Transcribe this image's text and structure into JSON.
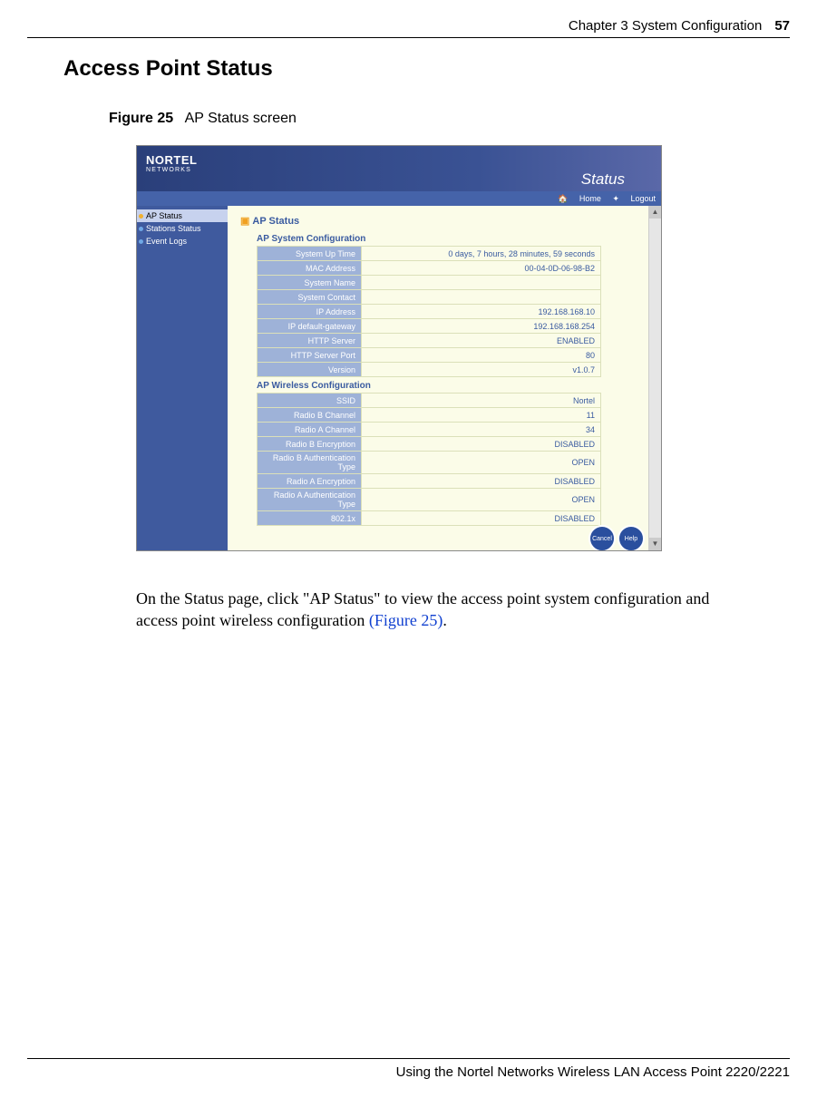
{
  "header": {
    "chapter": "Chapter 3  System Configuration",
    "page_number": "57"
  },
  "section_title": "Access Point Status",
  "figure": {
    "label": "Figure 25",
    "caption": "AP Status screen"
  },
  "banner": {
    "brand": "NORTEL",
    "brand_sub": "NETWORKS",
    "title": "Status"
  },
  "topbar": {
    "home": "Home",
    "logout": "Logout"
  },
  "sidebar": {
    "items": [
      {
        "label": "AP Status",
        "active": true
      },
      {
        "label": "Stations Status",
        "active": false
      },
      {
        "label": "Event Logs",
        "active": false
      }
    ]
  },
  "ap_status_heading": "AP Status",
  "sections": [
    {
      "title": "AP System Configuration",
      "rows": [
        {
          "label": "System Up Time",
          "value": "0 days, 7 hours, 28 minutes, 59 seconds"
        },
        {
          "label": "MAC Address",
          "value": "00-04-0D-06-98-B2"
        },
        {
          "label": "System Name",
          "value": ""
        },
        {
          "label": "System Contact",
          "value": ""
        },
        {
          "label": "IP Address",
          "value": "192.168.168.10"
        },
        {
          "label": "IP default-gateway",
          "value": "192.168.168.254"
        },
        {
          "label": "HTTP Server",
          "value": "ENABLED"
        },
        {
          "label": "HTTP Server Port",
          "value": "80"
        },
        {
          "label": "Version",
          "value": "v1.0.7"
        }
      ]
    },
    {
      "title": "AP Wireless Configuration",
      "rows": [
        {
          "label": "SSID",
          "value": "Nortel"
        },
        {
          "label": "Radio B Channel",
          "value": "11"
        },
        {
          "label": "Radio A Channel",
          "value": "34"
        },
        {
          "label": "Radio B Encryption",
          "value": "DISABLED"
        },
        {
          "label": "Radio B Authentication Type",
          "value": "OPEN"
        },
        {
          "label": "Radio A Encryption",
          "value": "DISABLED"
        },
        {
          "label": "Radio A Authentication Type",
          "value": "OPEN"
        },
        {
          "label": "802.1x",
          "value": "DISABLED"
        }
      ]
    }
  ],
  "round_buttons": {
    "cancel": "Cancel",
    "help": "Help"
  },
  "body_text": {
    "pre": "On the Status page, click \"AP Status\" to view the access point system configuration and access point wireless configuration ",
    "link": "(Figure 25)",
    "post": "."
  },
  "footer": "Using the Nortel Networks Wireless LAN Access Point 2220/2221"
}
